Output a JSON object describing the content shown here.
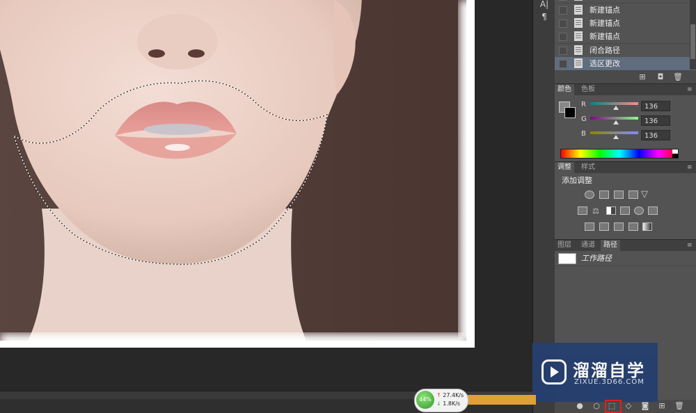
{
  "history": {
    "items": [
      {
        "label": "新建锚点",
        "selected": false
      },
      {
        "label": "新建锚点",
        "selected": false
      },
      {
        "label": "新建锚点",
        "selected": false
      },
      {
        "label": "闭合路径",
        "selected": false
      },
      {
        "label": "选区更改",
        "selected": true
      }
    ]
  },
  "color_panel": {
    "tabs": [
      "颜色",
      "色板"
    ],
    "channels": [
      {
        "name": "R",
        "value": "136"
      },
      {
        "name": "G",
        "value": "136"
      },
      {
        "name": "B",
        "value": "136"
      }
    ],
    "foreground_color": "#888888",
    "background_color": "#000000"
  },
  "adjustments_panel": {
    "tabs": [
      "调整",
      "样式"
    ],
    "heading": "添加调整"
  },
  "layers_panel": {
    "tabs": [
      "图层",
      "通道",
      "路径"
    ],
    "paths": [
      {
        "name": "工作路径"
      }
    ]
  },
  "network_widget": {
    "percent": "44%",
    "upload": "27.4K/s",
    "download": "1.8K/s"
  },
  "watermark": {
    "title": "溜溜自学",
    "subtitle": "ZIXUE.3D66.COM"
  }
}
